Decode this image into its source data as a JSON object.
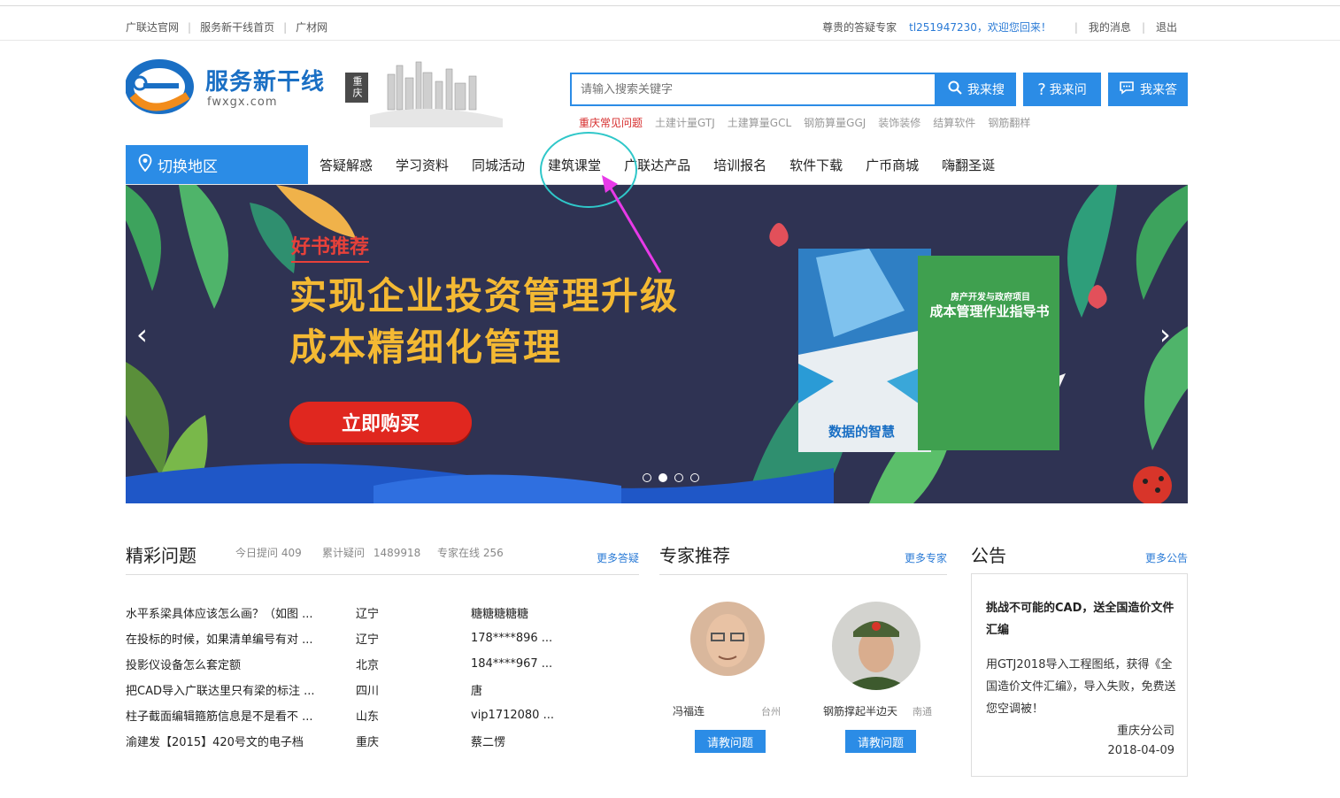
{
  "topbar": {
    "links": [
      "广联达官网",
      "服务新干线首页",
      "广材网"
    ],
    "greeting": "尊贵的答疑专家",
    "user": "tl251947230，欢迎您回来！",
    "messages": "我的消息",
    "logout": "退出"
  },
  "logo": {
    "name": "服务新干线",
    "domain": "fwxgx.com",
    "city": "重庆"
  },
  "search": {
    "placeholder": "请输入搜索关键字",
    "search_btn": "我来搜",
    "ask_btn": "我来问",
    "answer_btn": "我来答",
    "hotwords": [
      "重庆常见问题",
      "土建计量GTJ",
      "土建算量GCL",
      "钢筋算量GGJ",
      "装饰装修",
      "结算软件",
      "钢筋翻样"
    ]
  },
  "nav": {
    "region": "切换地区",
    "items": [
      "答疑解惑",
      "学习资料",
      "同城活动",
      "建筑课堂",
      "广联达产品",
      "培训报名",
      "软件下载",
      "广币商城",
      "嗨翻圣诞"
    ]
  },
  "banner": {
    "tag": "好书推荐",
    "title1": "实现企业投资管理升级",
    "title2": "成本精细化管理",
    "buy": "立即购买",
    "book1_title": "数据的智慧",
    "book2_sub": "房产开发与政府项目",
    "book2_title": "成本管理作业指导书",
    "active_slide": 2,
    "slide_count": 4
  },
  "questions": {
    "title": "精彩问题",
    "today_label": "今日提问",
    "today": "409",
    "total_label": "累计疑问",
    "total": "1489918",
    "online_label": "专家在线",
    "online": "256",
    "more": "更多答疑",
    "rows": [
      {
        "q": "水平系梁具体应该怎么画？（如图 ...",
        "region": "辽宁",
        "user": "糖糖糖糖糖"
      },
      {
        "q": "在投标的时候，如果清单编号有对 ...",
        "region": "辽宁",
        "user": "178****896 ..."
      },
      {
        "q": "投影仪设备怎么套定额",
        "region": "北京",
        "user": "184****967 ..."
      },
      {
        "q": "把CAD导入广联达里只有梁的标注 ...",
        "region": "四川",
        "user": "唐"
      },
      {
        "q": "柱子截面编辑箍筋信息是不是看不 ...",
        "region": "山东",
        "user": "vip1712080 ..."
      },
      {
        "q": "渝建发【2015】420号文的电子档",
        "region": "重庆",
        "user": "蔡二愣"
      }
    ]
  },
  "experts": {
    "title": "专家推荐",
    "more": "更多专家",
    "items": [
      {
        "name": "冯福连",
        "city": "台州",
        "button": "请教问题"
      },
      {
        "name": "钢筋撑起半边天",
        "city": "南通",
        "button": "请教问题"
      }
    ]
  },
  "notice": {
    "title": "公告",
    "more": "更多公告",
    "headline": "挑战不可能的CAD，送全国造价文件汇编",
    "body": "用GTJ2018导入工程图纸，获得《全国造价文件汇编》，导入失败，免费送您空调被！",
    "org": "重庆分公司",
    "date": "2018-04-09"
  },
  "colors": {
    "brand": "#2b8ce6",
    "highlight": "#2fc7c9",
    "arrow": "#e83ae8",
    "banner_bg": "#2f3353"
  }
}
